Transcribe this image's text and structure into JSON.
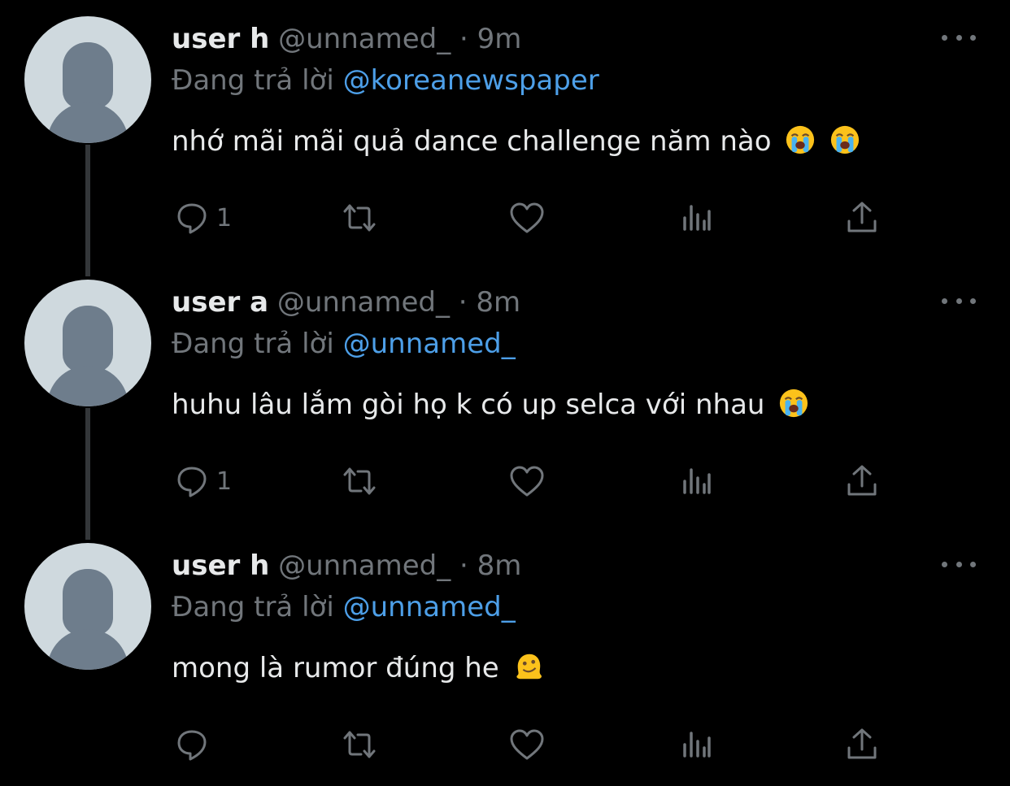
{
  "colors": {
    "background": "#000000",
    "text": "#e7e9ea",
    "secondary": "#71767b",
    "link": "#4d9fe8",
    "thread_line": "#333639"
  },
  "tweets": [
    {
      "display_name": "user h",
      "handle": "@unnamed_",
      "separator": "·",
      "time": "9m",
      "reply_prefix": "Đang trả lời",
      "reply_to": "@koreanewspaper",
      "text": "nhớ mãi mãi quả dance challenge năm nào",
      "emojis": [
        "loudly-crying-face",
        "loudly-crying-face"
      ],
      "reply_count": "1",
      "icons": [
        "reply-icon",
        "retweet-icon",
        "like-icon",
        "views-icon",
        "share-icon",
        "more-icon"
      ]
    },
    {
      "display_name": "user a",
      "handle": "@unnamed_",
      "separator": "·",
      "time": "8m",
      "reply_prefix": "Đang trả lời",
      "reply_to": "@unnamed_",
      "text": "huhu lâu lắm gòi họ k có up selca với nhau",
      "emojis": [
        "loudly-crying-face"
      ],
      "reply_count": "1",
      "icons": [
        "reply-icon",
        "retweet-icon",
        "like-icon",
        "views-icon",
        "share-icon",
        "more-icon"
      ]
    },
    {
      "display_name": "user h",
      "handle": "@unnamed_",
      "separator": "·",
      "time": "8m",
      "reply_prefix": "Đang trả lời",
      "reply_to": "@unnamed_",
      "text": "mong là rumor đúng he",
      "emojis": [
        "melting-face"
      ],
      "reply_count": "",
      "icons": [
        "reply-icon",
        "retweet-icon",
        "like-icon",
        "views-icon",
        "share-icon",
        "more-icon"
      ]
    }
  ]
}
